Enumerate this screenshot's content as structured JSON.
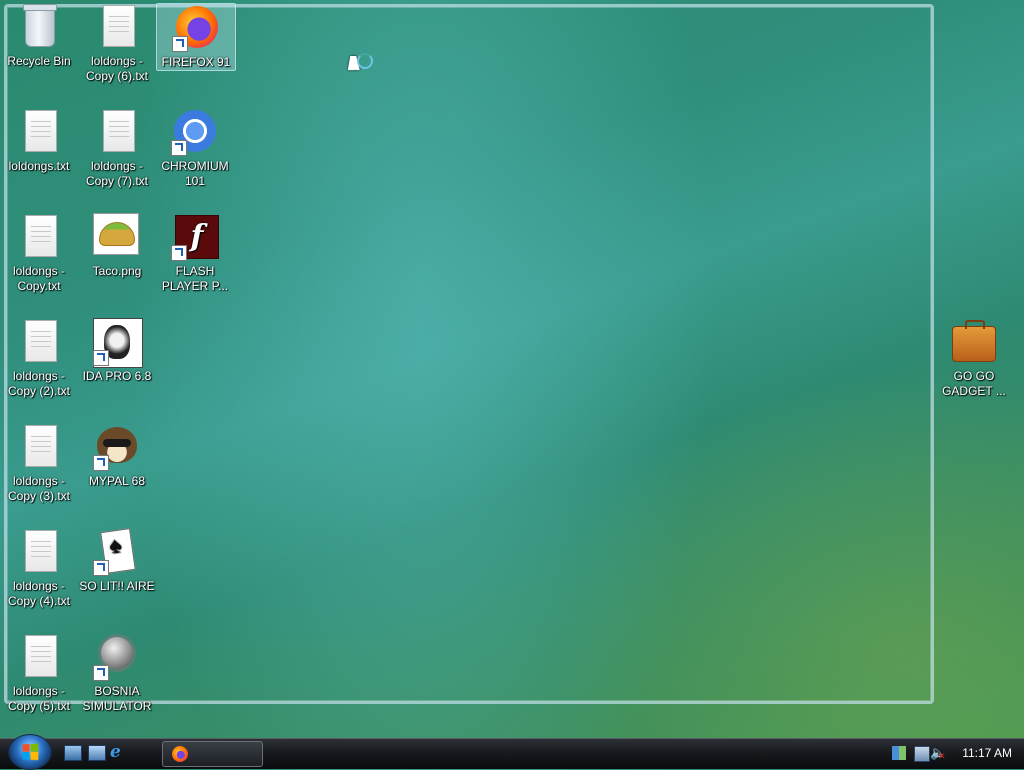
{
  "desktop": {
    "icons": [
      {
        "label": "Recycle Bin",
        "type": "recycle-bin"
      },
      {
        "label": "loldongs - Copy (6).txt",
        "type": "text-file"
      },
      {
        "label": "FIREFOX 91",
        "type": "firefox",
        "selected": true
      },
      {
        "label": "loldongs.txt",
        "type": "text-file"
      },
      {
        "label": "loldongs - Copy (7).txt",
        "type": "text-file"
      },
      {
        "label": "CHROMIUM 101",
        "type": "chromium"
      },
      {
        "label": "loldongs - Copy.txt",
        "type": "text-file"
      },
      {
        "label": "Taco.png",
        "type": "image-file"
      },
      {
        "label": "FLASH PLAYER P...",
        "type": "flash"
      },
      {
        "label": "loldongs - Copy (2).txt",
        "type": "text-file"
      },
      {
        "label": "IDA PRO 6.8",
        "type": "ida"
      },
      {
        "label": "loldongs - Copy (3).txt",
        "type": "text-file"
      },
      {
        "label": "MYPAL 68",
        "type": "mypal"
      },
      {
        "label": "loldongs - Copy (4).txt",
        "type": "text-file"
      },
      {
        "label": "SO LIT!! AIRE",
        "type": "solitaire"
      },
      {
        "label": "loldongs - Copy (5).txt",
        "type": "text-file"
      },
      {
        "label": "BOSNIA SIMULATOR",
        "type": "bosnia"
      },
      {
        "label": "GO GO GADGET ...",
        "type": "briefcase"
      }
    ]
  },
  "taskbar": {
    "start_label": "Start",
    "quick_launch": [
      "show-desktop-icon",
      "flip-3d-icon",
      "internet-explorer-icon"
    ],
    "tasks": [
      {
        "app": "firefox-icon",
        "label": ""
      }
    ],
    "tray_icons": [
      "windows-security-icon",
      "network-icon",
      "volume-muted-icon"
    ],
    "clock": "11:17 AM"
  }
}
